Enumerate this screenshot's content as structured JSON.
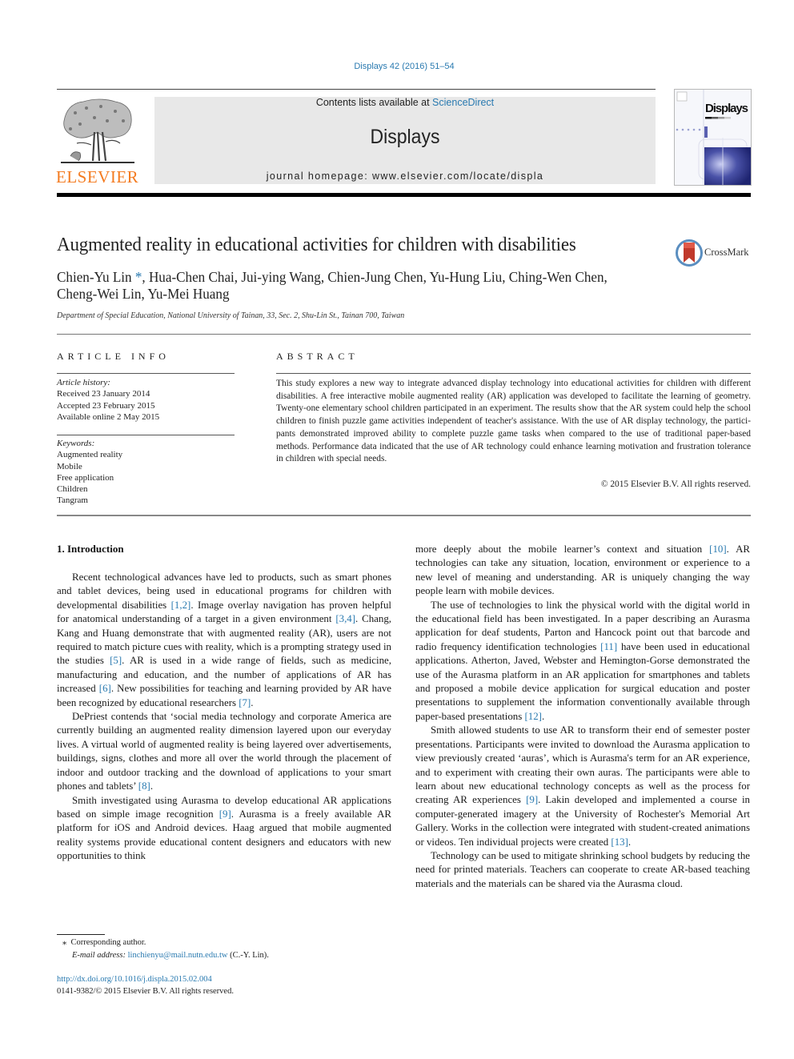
{
  "header": {
    "journal_ref": "Displays 42 (2016) 51–54",
    "contents_prefix": "Contents lists available at ",
    "contents_link": "ScienceDirect",
    "journal_name": "Displays",
    "homepage": "journal homepage: www.elsevier.com/locate/displa",
    "publisher_logo_text": "ELSEVIER",
    "cover_title": "Displays",
    "colors": {
      "link": "#2a7ab0",
      "elsevier_orange": "#f47b20",
      "masthead_bg": "#e8e8e8"
    }
  },
  "article": {
    "title": "Augmented reality in educational activities for children with disabilities",
    "crossmark_label": "CrossMark",
    "authors_line1_first": "Chien-Yu Lin ",
    "authors_star": "*",
    "authors_line1_rest": ", Hua-Chen Chai, Jui-ying Wang, Chien-Jung Chen, Yu-Hung Liu, Ching-Wen Chen,",
    "authors_line2": "Cheng-Wei Lin, Yu-Mei Huang",
    "affiliation": "Department of Special Education, National University of Tainan, 33, Sec. 2, Shu-Lin St., Tainan 700, Taiwan"
  },
  "article_info": {
    "heading": "ARTICLE INFO",
    "history_label": "Article history:",
    "history": [
      "Received 23 January 2014",
      "Accepted 23 February 2015",
      "Available online 2 May 2015"
    ],
    "keywords_label": "Keywords:",
    "keywords": [
      "Augmented reality",
      "Mobile",
      "Free application",
      "Children",
      "Tangram"
    ]
  },
  "abstract": {
    "heading": "ABSTRACT",
    "text": "This study explores a new way to integrate advanced display technology into educational activities for children with different disabilities. A free interactive mobile augmented reality (AR) application was developed to facilitate the learning of geometry. Twenty-one elementary school children participated in an experiment. The results show that the AR system could help the school children to finish puzzle game activities independent of teacher's assistance. With the use of AR display technology, the partici­pants demonstrated improved ability to complete puzzle game tasks when compared to the use of tradi­tional paper-based methods. Performance data indicated that the use of AR technology could enhance learning motivation and frustration tolerance in children with special needs.",
    "copyright": "© 2015 Elsevier B.V. All rights reserved."
  },
  "body": {
    "section_heading": "1. Introduction",
    "left": [
      [
        {
          "t": "Recent technological advances have led to products, such as smart phones and tablet devices, being used in educational pro­grams for children with developmental disabilities "
        },
        {
          "ref": "[1,2]"
        },
        {
          "t": ". Image overlay navigation has proven helpful for anatomical understand­ing of a target in a given environment "
        },
        {
          "ref": "[3,4]"
        },
        {
          "t": ". Chang, Kang and Huang demonstrate that with augmented reality (AR), users are not required to match picture cues with reality, which is a prompt­ing strategy used in the studies "
        },
        {
          "ref": "[5]"
        },
        {
          "t": ". AR is used in a wide range of fields, such as medicine, manufacturing and education, and the number of applications of AR has increased "
        },
        {
          "ref": "[6]"
        },
        {
          "t": ". New possibilities for teaching and learning provided by AR have been recognized by educational researchers "
        },
        {
          "ref": "[7]"
        },
        {
          "t": "."
        }
      ],
      [
        {
          "t": "DePriest contends that ‘social media technology and corporate America are currently building an augmented reality dimension layered upon our everyday lives. A virtual world of augmented reality is being layered over advertisements, buildings, signs, clothes and more all over the world through the placement of indoor and outdoor tracking and the download of applications to your smart phones and tablets’ "
        },
        {
          "ref": "[8]"
        },
        {
          "t": "."
        }
      ],
      [
        {
          "t": "Smith investigated using Aurasma to develop educational AR applications based on simple image recognition "
        },
        {
          "ref": "[9]"
        },
        {
          "t": ". Aurasma is a freely available AR platform for iOS and Android devices. Haag argued that mobile augmented reality systems provide educational content designers and educators with new opportunities to think"
        }
      ]
    ],
    "right": [
      [
        {
          "t": "more deeply about the mobile learner’s context and situation "
        },
        {
          "ref": "[10]"
        },
        {
          "t": ". AR technologies can take any situation, location, environment or experience to a new level of meaning and understanding. AR is uniquely changing the way people learn with mobile devices."
        }
      ],
      [
        {
          "t": "The use of technologies to link the physical world with the dig­ital world in the educational field has been investigated. In a paper describing an Aurasma application for deaf students, Parton and Hancock point out that barcode and radio frequency identification technologies "
        },
        {
          "ref": "[11]"
        },
        {
          "t": " have been used in educational applications. Atherton, Javed, Webster and Hemington-Gorse demonstrated the use of the Aurasma platform in an AR application for smartphones and tablets and proposed a mobile device application for surgical education and poster presentations to supplement the information conventionally available through paper-based presen­tations "
        },
        {
          "ref": "[12]"
        },
        {
          "t": "."
        }
      ],
      [
        {
          "t": "Smith allowed students to use AR to transform their end of semester poster presentations. Participants were invited to down­load the Aurasma application to view previously created ‘auras’, which is Aurasma's term for an AR experience, and to experiment with creating their own auras. The participants were able to learn about new educational technology concepts as well as the process for creating AR experiences "
        },
        {
          "ref": "[9]"
        },
        {
          "t": ". Lakin developed and implemented a course in computer-generated imagery at the University of Rochester's Memorial Art Gallery. Works in the collection were integrated with student-created animations or videos. Ten individ­ual projects were created "
        },
        {
          "ref": "[13]"
        },
        {
          "t": "."
        }
      ],
      [
        {
          "t": "Technology can be used to mitigate shrinking school budgets by reducing the need for printed materials. Teachers can cooperate to create AR-based teaching materials and the materials can be shared via the Aurasma cloud."
        }
      ]
    ]
  },
  "footnote": {
    "star": "⁎",
    "corresponding": "Corresponding author.",
    "email_label": "E-mail address:",
    "email": "linchienyu@mail.nutn.edu.tw",
    "email_suffix": " (C.-Y. Lin)."
  },
  "doi": {
    "url": "http://dx.doi.org/10.1016/j.displa.2015.02.004",
    "issn_line": "0141-9382/© 2015 Elsevier B.V. All rights reserved."
  }
}
